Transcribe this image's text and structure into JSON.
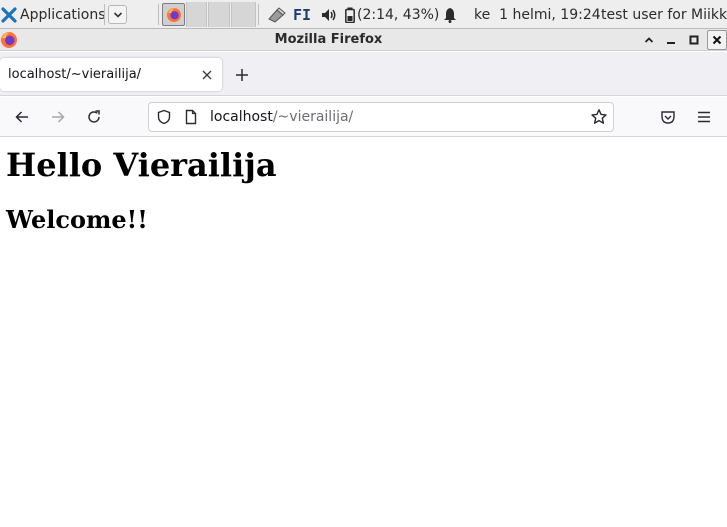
{
  "panel": {
    "applications_label": "Applications",
    "applications_separator": "∷",
    "keyboard_layout": "FI",
    "battery_text": "(2:14, 43%)",
    "clock": "ke  1 helmi, 19:24",
    "user": "test user for Miikka"
  },
  "window": {
    "title": "Mozilla Firefox"
  },
  "browser": {
    "tab_title": "localhost/~vierailija/",
    "url_host": "localhost",
    "url_path": "/~vierailija/"
  },
  "page": {
    "heading": "Hello Vierailija",
    "subheading": "Welcome!!"
  },
  "colors": {
    "panel_bg": "#eeeeee",
    "firefox_orange": "#ff7139",
    "firefox_purple": "#6e3cc7"
  }
}
